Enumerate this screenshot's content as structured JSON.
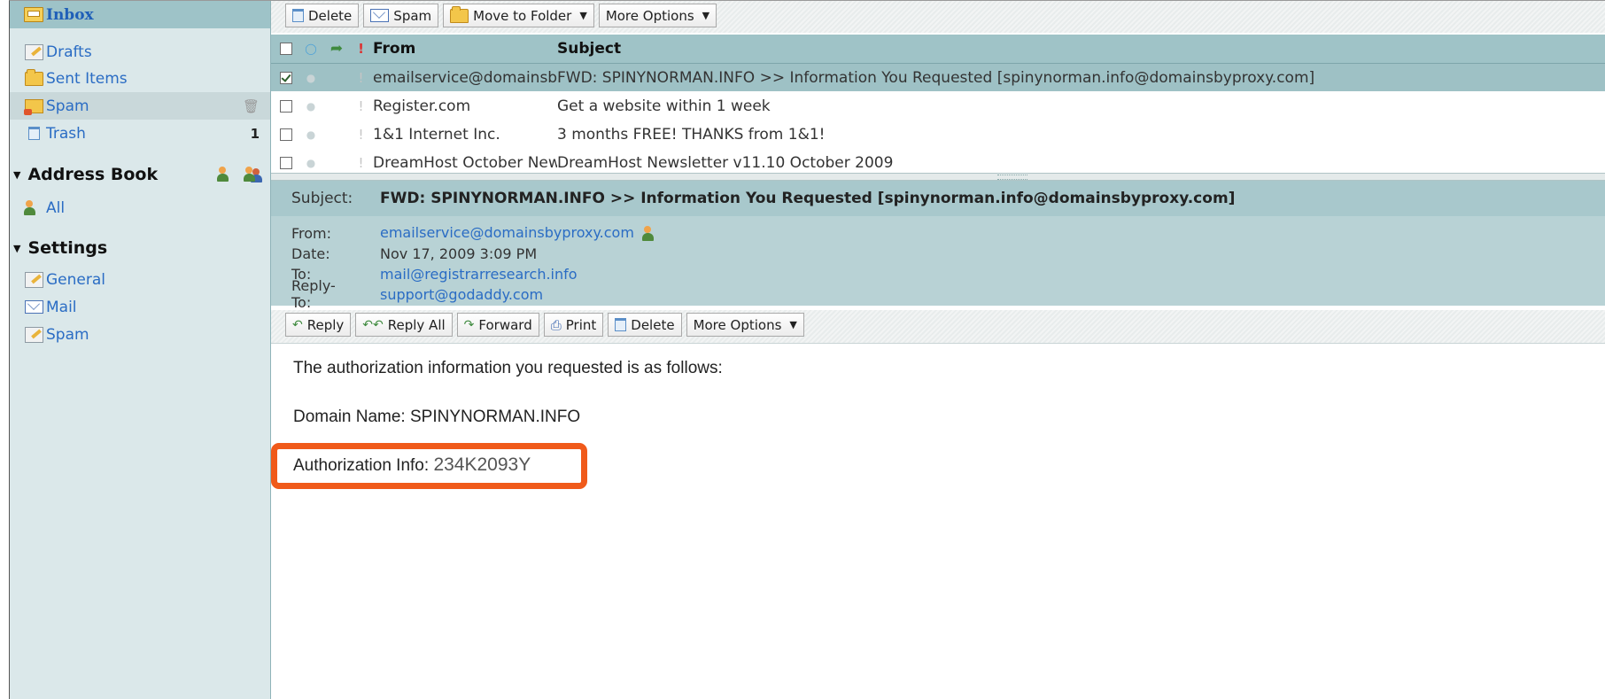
{
  "sidebar": {
    "folders": [
      {
        "label": "Inbox",
        "icon": "inbox-icon",
        "count": ""
      },
      {
        "label": "Drafts",
        "icon": "folder-icon",
        "count": ""
      },
      {
        "label": "Sent Items",
        "icon": "folder-icon",
        "count": ""
      },
      {
        "label": "Spam",
        "icon": "spam-folder-icon",
        "count": ""
      },
      {
        "label": "Trash",
        "icon": "trash-icon",
        "count": "1"
      }
    ],
    "address_book": {
      "title": "Address Book",
      "items": [
        {
          "label": "All",
          "icon": "contacts-icon"
        }
      ]
    },
    "settings": {
      "title": "Settings",
      "items": [
        {
          "label": "General",
          "icon": "settings-general-icon"
        },
        {
          "label": "Mail",
          "icon": "mail-envelope-icon"
        },
        {
          "label": "Spam",
          "icon": "settings-spam-icon"
        }
      ]
    }
  },
  "toolbar": {
    "delete": "Delete",
    "spam": "Spam",
    "move_to_folder": "Move to Folder",
    "more_options": "More Options"
  },
  "message_list": {
    "columns": {
      "from": "From",
      "subject": "Subject"
    },
    "rows": [
      {
        "from": "emailservice@domainsbyproxy.com",
        "subject": "FWD: SPINYNORMAN.INFO >> Information You Requested [spinynorman.info@domainsbyproxy.com]",
        "checked": true,
        "selected": true
      },
      {
        "from": "Register.com",
        "subject": "Get a website within 1 week",
        "checked": false,
        "selected": false
      },
      {
        "from": "1&1 Internet Inc.",
        "subject": "3 months FREE! THANKS from 1&1!",
        "checked": false,
        "selected": false
      },
      {
        "from": "DreamHost October Newsletter",
        "subject": "DreamHost Newsletter v11.10 October 2009",
        "checked": false,
        "selected": false
      }
    ]
  },
  "preview": {
    "subject_label": "Subject:",
    "subject": "FWD: SPINYNORMAN.INFO >> Information You Requested [spinynorman.info@domainsbyproxy.com]",
    "from_label": "From:",
    "from": "emailservice@domainsbyproxy.com",
    "date_label": "Date:",
    "date": "Nov 17, 2009 3:09 PM",
    "to_label": "To:",
    "to": "mail@registrarresearch.info",
    "reply_to_label": "Reply-To:",
    "reply_to": "support@godaddy.com"
  },
  "message_toolbar": {
    "reply": "Reply",
    "reply_all": "Reply All",
    "forward": "Forward",
    "print": "Print",
    "delete": "Delete",
    "more_options": "More Options"
  },
  "body": {
    "intro": "The authorization information you requested is as follows:",
    "domain_line": "Domain Name: SPINYNORMAN.INFO",
    "auth_label": "Authorization Info:",
    "auth_value": "234K2093Y"
  },
  "colors": {
    "highlight": "#f05a1a",
    "sidebar_bg": "#dbe8ea",
    "selected_row": "#9ec1c5",
    "link": "#2a6cc4"
  }
}
